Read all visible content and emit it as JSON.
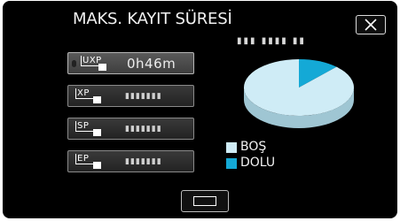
{
  "title": "MAKS. KAYIT SÜRESİ",
  "remaining_value": "▮▮▮ ▮▮▮▮ ▮▮",
  "modes": [
    {
      "label": "UXP",
      "value": "0h46m",
      "selected": true
    },
    {
      "label": "XP",
      "value": "▮▮▮▮▮▮▮",
      "selected": false
    },
    {
      "label": "SP",
      "value": "▮▮▮▮▮▮▮",
      "selected": false
    },
    {
      "label": "EP",
      "value": "▮▮▮▮▮▮▮",
      "selected": false
    }
  ],
  "legend": {
    "free_label": "BOŞ",
    "used_label": "DOLU"
  },
  "chart_data": {
    "type": "pie",
    "slices": [
      {
        "name": "BOŞ",
        "value": 88
      },
      {
        "name": "DOLU",
        "value": 12
      }
    ],
    "colors": {
      "free": "#cfecf6",
      "used": "#14a9d6"
    }
  },
  "icons": {
    "close": "close-x-icon",
    "back": "back-rectangle-icon"
  }
}
